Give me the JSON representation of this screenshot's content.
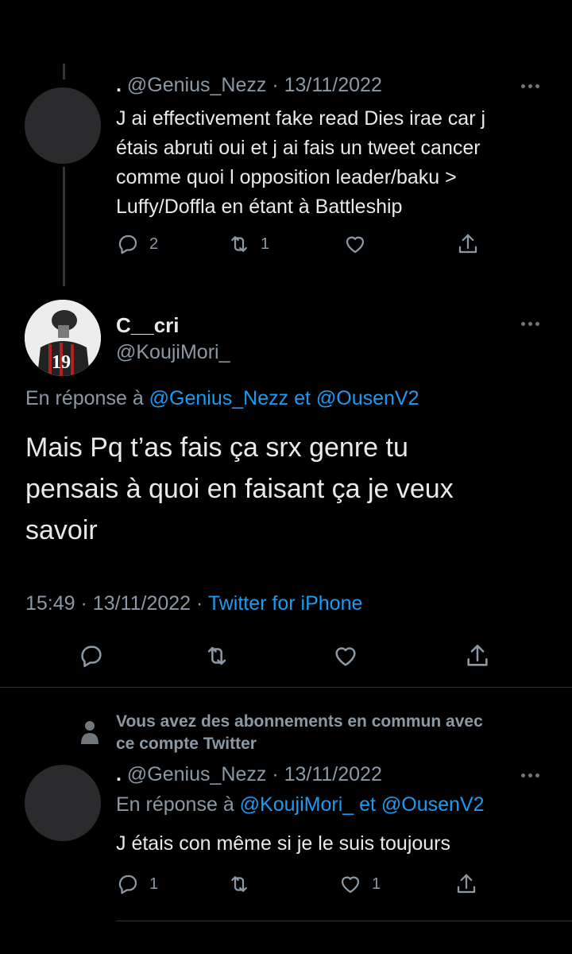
{
  "tweet1": {
    "display_name": ".",
    "handle": "@Genius_Nezz",
    "date": "13/11/2022",
    "text_lines": [
      "J ai effectivement fake read Dies irae car j",
      "étais abruti oui et j ai fais un tweet cancer",
      "comme quoi l opposition leader/baku >",
      "Luffy/Doffla en étant à Battleship"
    ],
    "reply_count": "2",
    "retweet_count": "1"
  },
  "main_tweet": {
    "display_name": "C__cri",
    "handle": "@KoujiMori_",
    "avatar_jersey": "19",
    "reply_prefix": "En réponse à",
    "mention1": "@Genius_Nezz",
    "conj": "et",
    "mention2": "@OusenV2",
    "text_lines": [
      "Mais Pq t’as fais ça srx genre tu",
      "pensais à quoi en faisant ça je veux",
      "savoir"
    ],
    "time": "15:49",
    "date": "13/11/2022",
    "source": "Twitter for iPhone"
  },
  "notice": {
    "line1": "Vous avez des abonnements en commun avec",
    "line2": "ce compte Twitter"
  },
  "tweet3": {
    "display_name": ".",
    "handle": "@Genius_Nezz",
    "date": "13/11/2022",
    "reply_prefix": "En réponse à",
    "mention1": "@KoujiMori_",
    "conj": "et",
    "mention2": "@OusenV2",
    "text": "J étais con même si je le suis toujours",
    "reply_count": "1",
    "like_count": "1"
  },
  "separator": "·",
  "colors": {
    "background": "#000000",
    "text": "#e7e9ea",
    "muted": "#8b98a5",
    "link": "#1d9bf0"
  }
}
